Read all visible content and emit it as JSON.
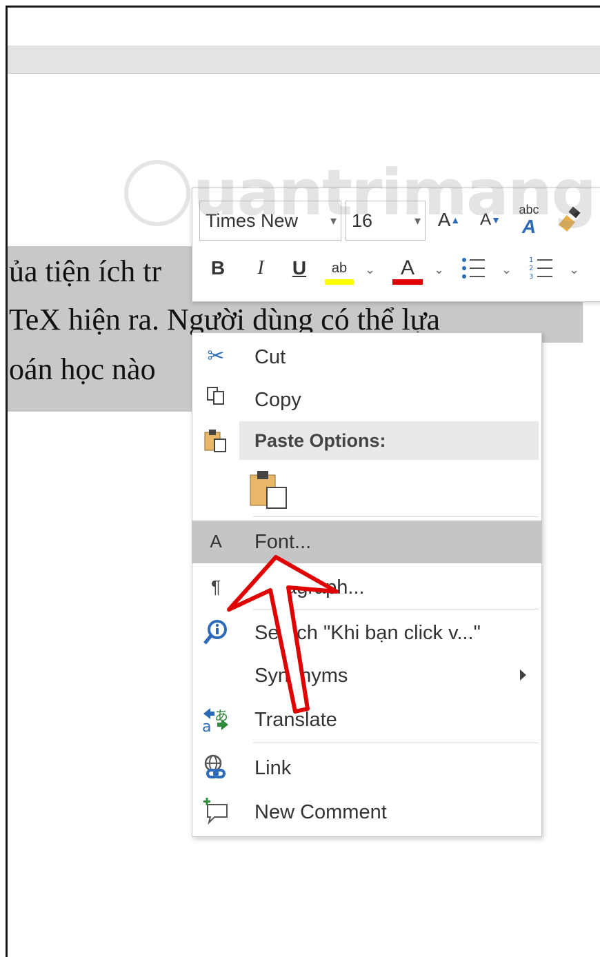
{
  "document": {
    "lines": [
      "ủa tiện ích tr",
      "TeX hiện ra. Người dùng có thể lựa",
      "oán học nào"
    ]
  },
  "watermark": {
    "text": "uantrimang"
  },
  "mini_toolbar": {
    "font_name": "Times New",
    "font_size": "16",
    "grow_font_label": "A",
    "shrink_font_label": "A",
    "styles_label": "abc",
    "bold_label": "B",
    "italic_label": "I",
    "underline_label": "U",
    "highlight_label": "ab",
    "font_color_label": "A",
    "highlight_color": "#ffff00",
    "font_color": "#e00000",
    "numbers_label": "1 2 3"
  },
  "context_menu": {
    "cut": "Cut",
    "copy": "Copy",
    "paste_options": "Paste Options:",
    "font": "Font...",
    "paragraph": "Paragraph...",
    "search": "Search \"Khi bạn click v...\"",
    "synonyms": "Synonyms",
    "translate": "Translate",
    "link": "Link",
    "new_comment": "New Comment",
    "font_icon_label": "A"
  },
  "colors": {
    "selection": "#c8c8c8",
    "hover": "#c5c5c5",
    "annotation_arrow": "#e00000"
  }
}
